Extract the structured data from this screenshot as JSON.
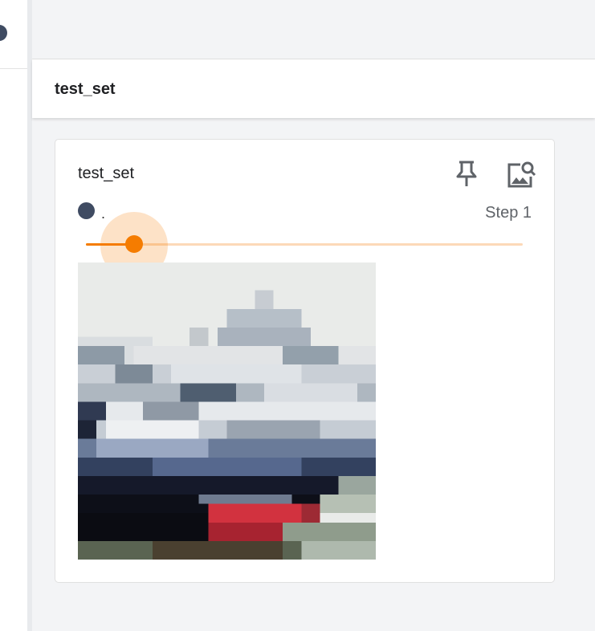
{
  "group": {
    "title": "test_set"
  },
  "card": {
    "title": "test_set",
    "run_name": ".",
    "step_label": "Step 1",
    "slider": {
      "value": 1,
      "min": 1,
      "max": 8
    },
    "run_color": "#3f4b62",
    "accent_color": "#f57c00",
    "icons": {
      "pin": "pin-icon",
      "inspect": "image-search-icon"
    }
  }
}
